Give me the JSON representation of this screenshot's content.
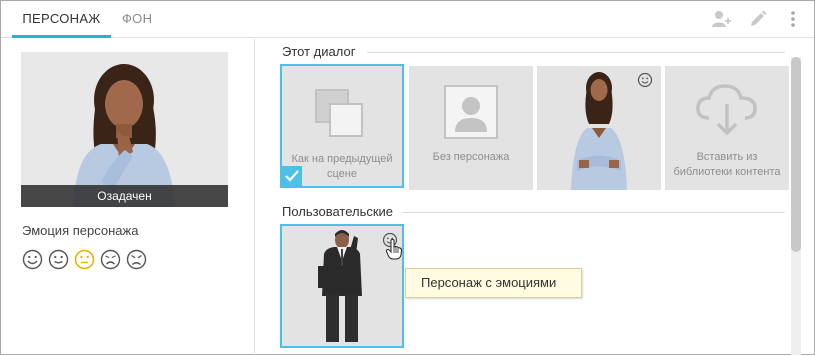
{
  "tabs": [
    {
      "label": "ПЕРСОНАЖ",
      "active": true
    },
    {
      "label": "ФОН",
      "active": false
    }
  ],
  "toolbar": {
    "icons": [
      "add-user-icon",
      "pencil-icon",
      "more-vertical-icon"
    ]
  },
  "preview": {
    "caption": "Озадачен"
  },
  "emotions": {
    "label": "Эмоция персонажа",
    "items": [
      "happy",
      "neutral",
      "puzzled",
      "sad",
      "angry"
    ],
    "selected": "puzzled"
  },
  "sections": {
    "this_dialog": {
      "title": "Этот диалог",
      "cards": [
        {
          "label": "Как на предыдущей сцене",
          "selected": true
        },
        {
          "label": "Без персонажа",
          "selected": false
        },
        {
          "label": "",
          "selected": false
        },
        {
          "label": "Вставить из библиотеки контента",
          "selected": false
        }
      ]
    },
    "custom": {
      "title": "Пользовательские",
      "cards": [
        {
          "label": "",
          "selected": true
        }
      ]
    }
  },
  "tooltip": "Персонаж с эмоциями",
  "colors": {
    "accent": "#2ab0d8",
    "selection": "#4cc0e6",
    "emotion_selected": "#e8b400",
    "tooltip_bg": "#fffbe0"
  }
}
